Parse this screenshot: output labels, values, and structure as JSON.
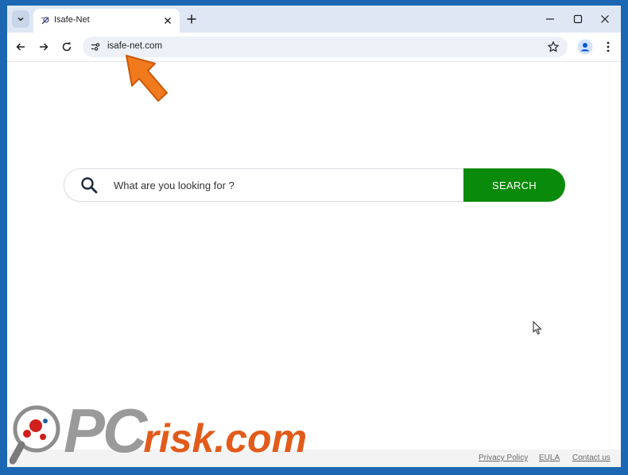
{
  "browser": {
    "tab": {
      "title": "Isafe-Net"
    },
    "address_bar": {
      "url": "isafe-net.com"
    }
  },
  "page": {
    "search": {
      "placeholder": "What are you looking for ?",
      "button_label": "SEARCH"
    },
    "footer": {
      "links": [
        "Privacy Policy",
        "EULA",
        "Contact us"
      ]
    }
  },
  "watermark": {
    "text_pc": "PC",
    "text_risk": "risk.com"
  },
  "colors": {
    "search_button": "#0a8a0a",
    "annotation_arrow": "#f07a1c",
    "desktop_background": "#1b67b3"
  }
}
